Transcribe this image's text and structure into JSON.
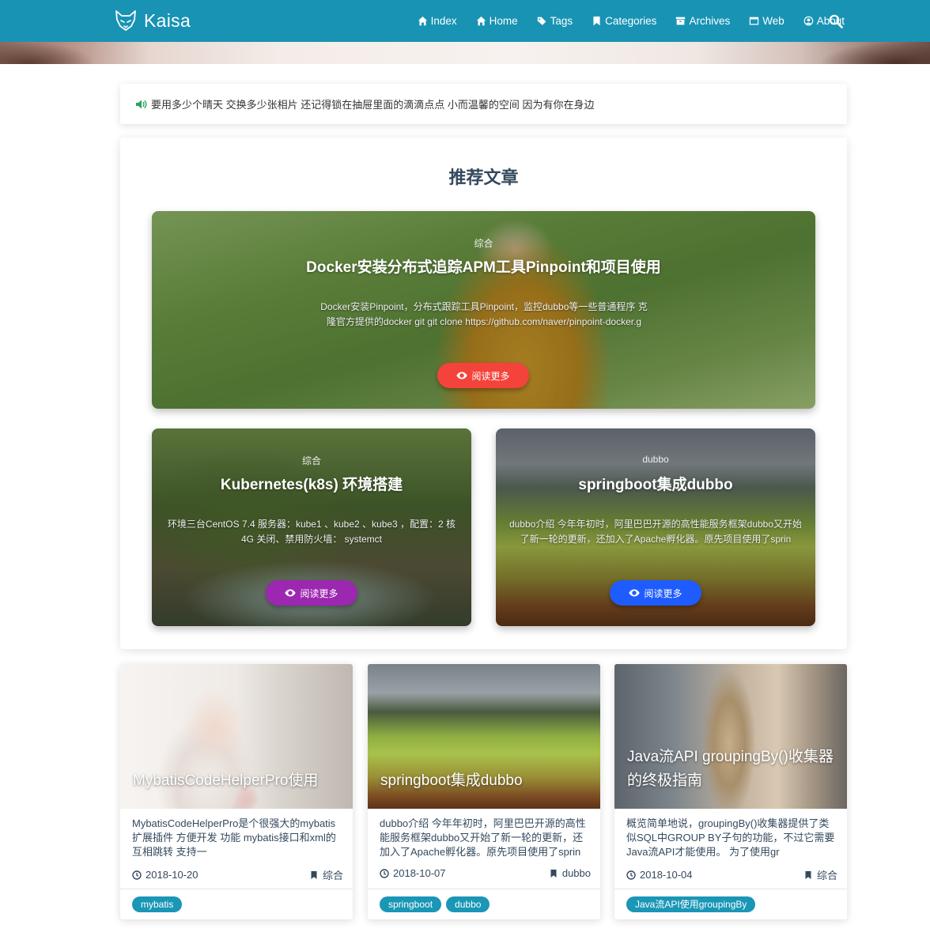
{
  "header": {
    "brand": "Kaisa",
    "nav": [
      {
        "label": "Index",
        "icon": "home-icon"
      },
      {
        "label": "Home",
        "icon": "home-icon"
      },
      {
        "label": "Tags",
        "icon": "tags-icon"
      },
      {
        "label": "Categories",
        "icon": "bookmark-icon"
      },
      {
        "label": "Archives",
        "icon": "archive-icon"
      },
      {
        "label": "Web",
        "icon": "window-icon"
      },
      {
        "label": "About",
        "icon": "user-circle-icon"
      }
    ],
    "search_icon": "search-icon",
    "color": "#1893b4"
  },
  "notice": {
    "icon": "volume-icon",
    "text": "要用多少个晴天 交换多少张相片 还记得锁在抽屉里面的滴滴点点 小而温馨的空间 因为有你在身边"
  },
  "recommend": {
    "title": "推荐文章",
    "items": [
      {
        "category": "综合",
        "title": "Docker安装分布式追踪APM工具Pinpoint和项目使用",
        "desc_line1": "Docker安装Pinpoint，分布式跟踪工具Pinpoint，监控dubbo等一些普通程序 克",
        "desc_line2": "隆官方提供的docker git git clone https://github.com/naver/pinpoint-docker.g",
        "button": "阅读更多",
        "button_color": "#f4433b"
      },
      {
        "category": "综合",
        "title": "Kubernetes(k8s) 环境搭建",
        "desc_line1": "环境三台CentOS 7.4 服务器：kube1 、kube2 、kube3 ，配置：2 核",
        "desc_line2": "4G 关闭、禁用防火墙： systemct",
        "button": "阅读更多",
        "button_color": "#9c27b0"
      },
      {
        "category": "dubbo",
        "title": "springboot集成dubbo",
        "desc_line1": "dubbo介绍 今年年初时，阿里巴巴开源的高性能服务框架dubbo又开始",
        "desc_line2": "了新一轮的更新，还加入了Apache孵化器。原先项目使用了sprin",
        "button": "阅读更多",
        "button_color": "#1e5cff"
      }
    ]
  },
  "posts": [
    {
      "title": "MybatisCodeHelperPro使用",
      "desc": "MybatisCodeHelperPro是个很强大的mybatis扩展插件 方便开发 功能 mybatis接口和xml的互相跳转 支持一",
      "date": "2018-10-20",
      "category": "综合",
      "tags": [
        "mybatis"
      ]
    },
    {
      "title": "springboot集成dubbo",
      "desc": "dubbo介绍 今年年初时，阿里巴巴开源的高性能服务框架dubbo又开始了新一轮的更新，还加入了Apache孵化器。原先项目使用了sprin",
      "date": "2018-10-07",
      "category": "dubbo",
      "tags": [
        "springboot",
        "dubbo"
      ]
    },
    {
      "title": "Java流API groupingBy()收集器的终极指南",
      "desc": "概览简单地说，groupingBy()收集器提供了类似SQL中GROUP BY子句的功能，不过它需要Java流API才能使用。 为了使用gr",
      "date": "2018-10-04",
      "category": "综合",
      "tags": [
        "Java流API使用groupingBy"
      ]
    }
  ],
  "tag_color": "#1a96b6"
}
